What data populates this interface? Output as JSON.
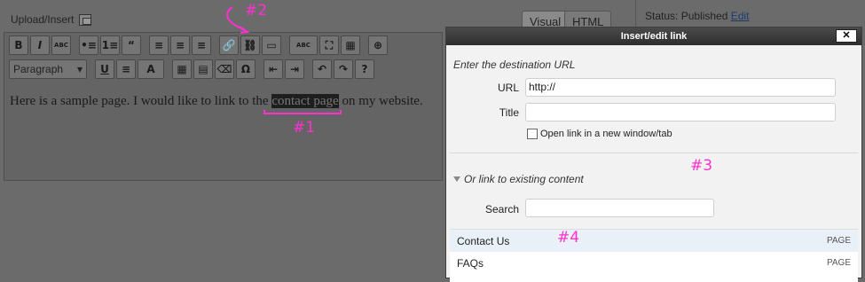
{
  "editor": {
    "upload_label": "Upload/Insert",
    "tab_visual": "Visual",
    "tab_html": "HTML",
    "format_select": "Paragraph",
    "body_text_before": "Here is a sample page.  I would like to link to the ",
    "body_text_selected": "contact page",
    "body_text_after": " on my website."
  },
  "publish": {
    "status_label": "Status: Published",
    "edit_link": "Edit"
  },
  "toolbar": {
    "row1": [
      "B",
      "I",
      "ABC",
      "•≡",
      "1≡",
      "“",
      "≡",
      "≡",
      "≡",
      "🔗",
      "⛓",
      "▭",
      "ABC",
      "⛶",
      "▦",
      "⊕"
    ],
    "row2": [
      "U",
      "≡",
      "A",
      "▦",
      "▤",
      "⌫",
      "Ω",
      "⇤",
      "⇥",
      "↶",
      "↷",
      "?"
    ]
  },
  "annotations": {
    "a1": "#1",
    "a2": "#2",
    "a3": "#3",
    "a4": "#4",
    "color": "#ff2fd0"
  },
  "modal": {
    "title": "Insert/edit link",
    "close_label": "✕",
    "hint": "Enter the destination URL",
    "url_label": "URL",
    "url_value": "http://",
    "title_label": "Title",
    "title_value": "",
    "new_window_label": "Open link in a new window/tab",
    "existing_toggle": "Or link to existing content",
    "search_label": "Search",
    "search_value": "",
    "results": [
      {
        "title": "Contact Us",
        "type": "PAGE"
      },
      {
        "title": "FAQs",
        "type": "PAGE"
      }
    ]
  }
}
